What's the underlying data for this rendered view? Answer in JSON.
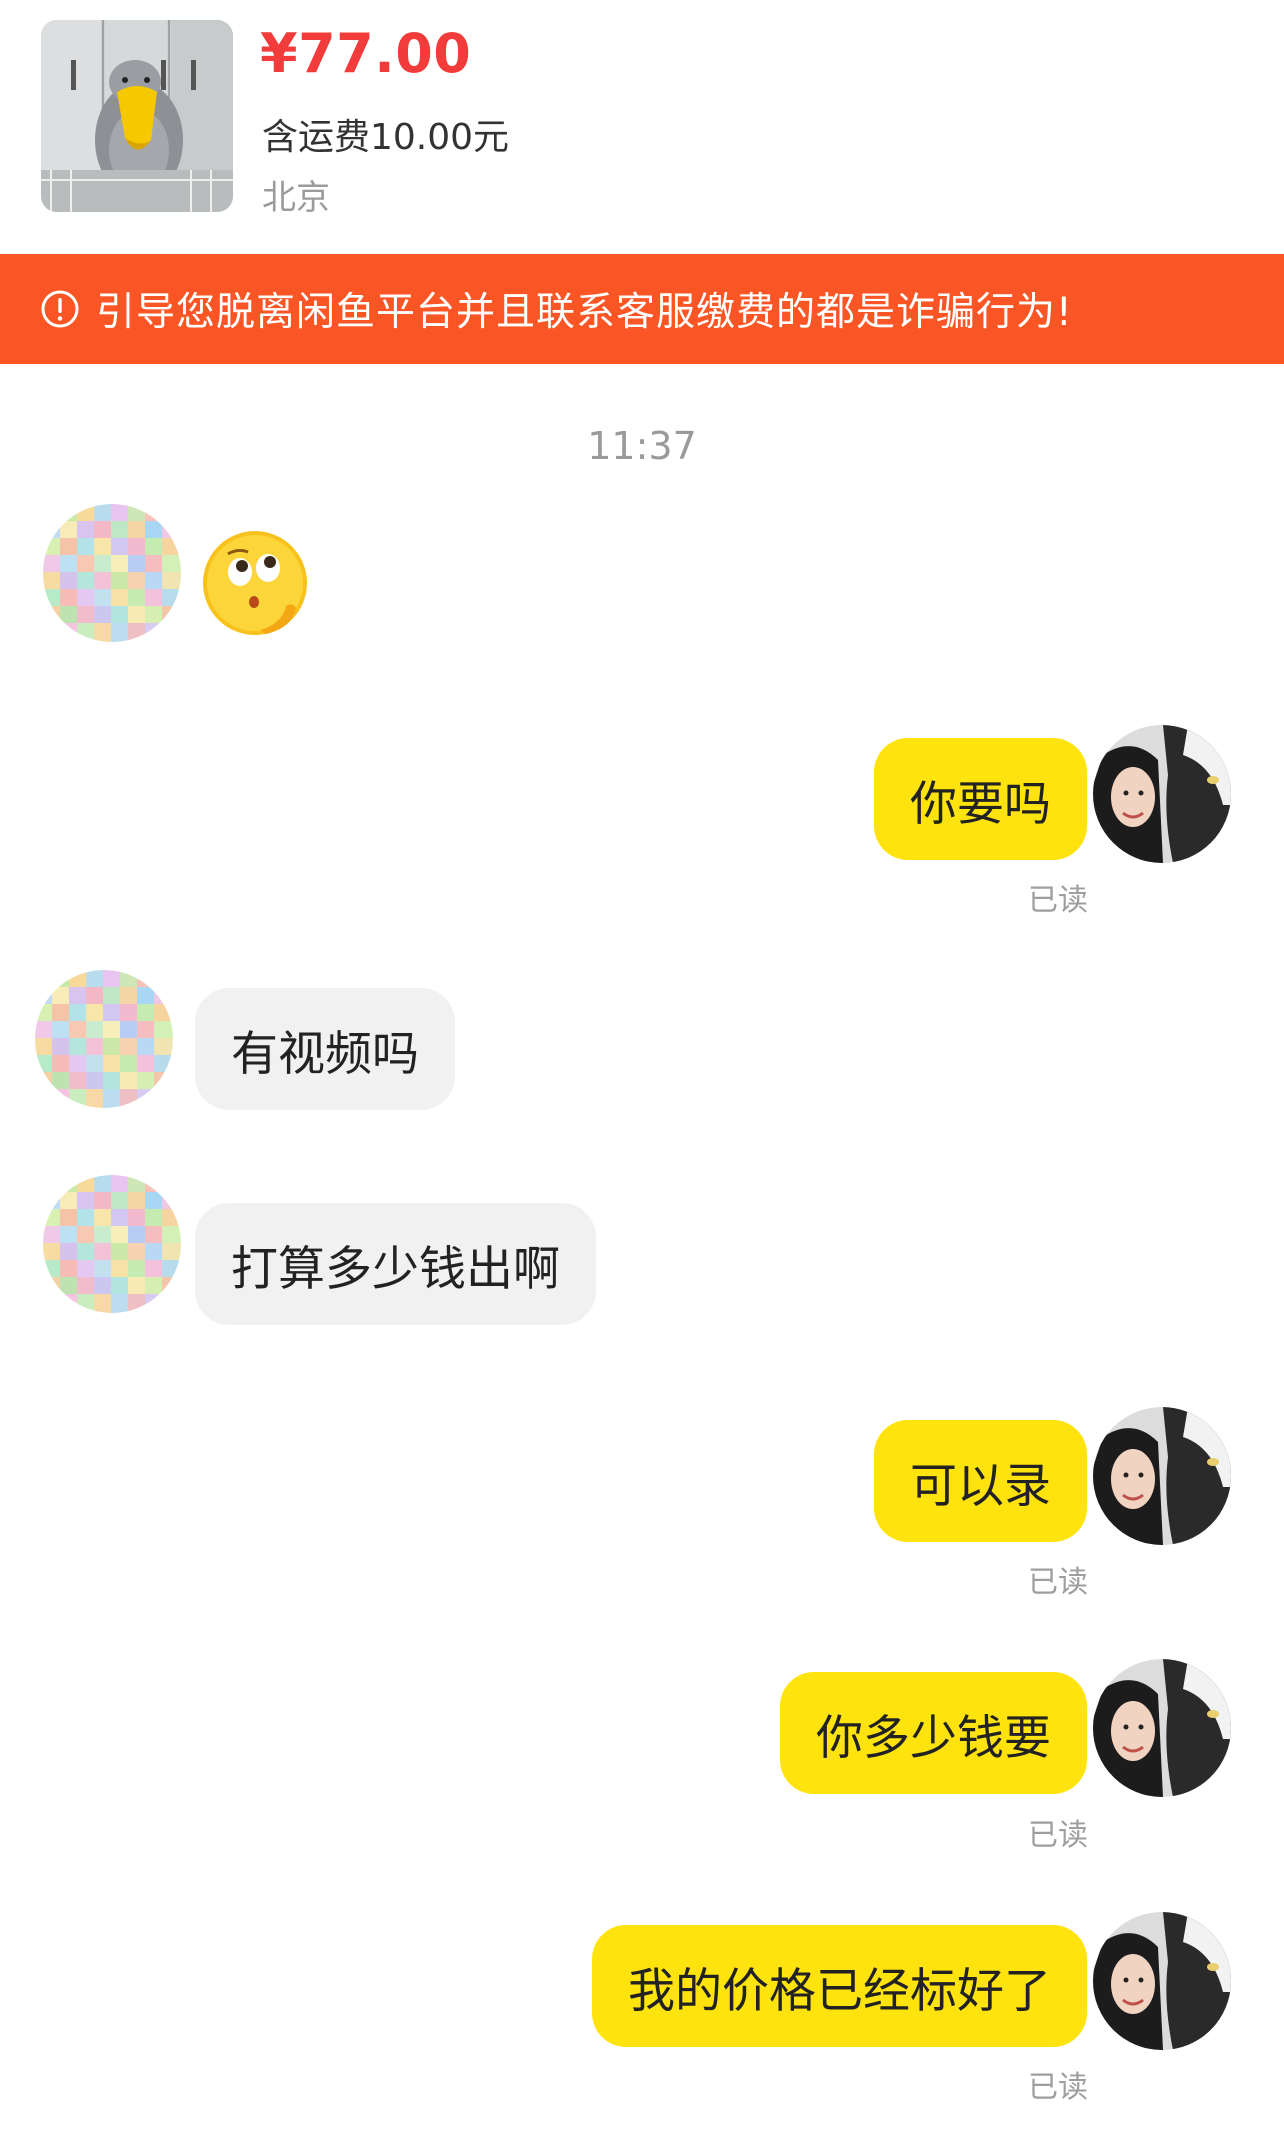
{
  "product": {
    "price": "¥77.00",
    "shipping": "含运费10.00元",
    "location": "北京",
    "thumbnail_icon": "toucan-plush-photo"
  },
  "banner": {
    "icon": "alert-circle-icon",
    "text": "引导您脱离闲鱼平台并且联系客服缴费的都是诈骗行为!"
  },
  "chat": {
    "timestamp": "11:37",
    "messages": [
      {
        "sender": "them",
        "type": "emoji",
        "emoji": "thinking-face-emoji"
      },
      {
        "sender": "me",
        "text": "你要吗",
        "status": "已读"
      },
      {
        "sender": "them",
        "text": "有视频吗"
      },
      {
        "sender": "them",
        "text": "打算多少钱出啊"
      },
      {
        "sender": "me",
        "text": "可以录",
        "status": "已读"
      },
      {
        "sender": "me",
        "text": "你多少钱要",
        "status": "已读"
      },
      {
        "sender": "me",
        "text": "我的价格已经标好了",
        "status": "已读"
      }
    ]
  },
  "colors": {
    "price": "#f23b3b",
    "banner": "#fa5524",
    "my_bubble": "#ffe30f",
    "their_bubble": "#f1f1f1"
  }
}
